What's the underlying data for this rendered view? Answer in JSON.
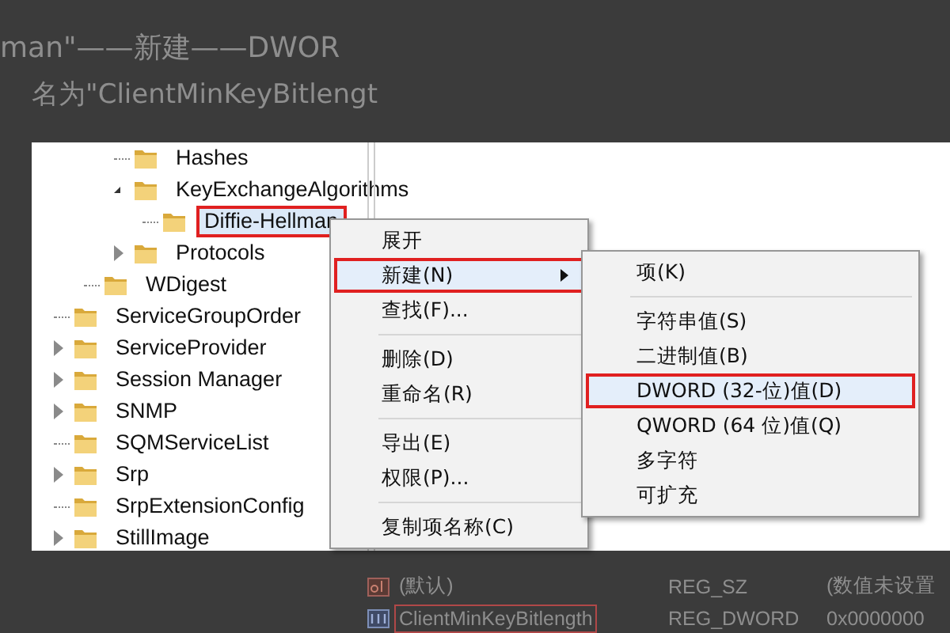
{
  "background_article": {
    "heading_line": "man\"——新建——DWOR",
    "text_line": "名为\"ClientMinKeyBitlengt",
    "values_table": [
      {
        "name": "(默认)",
        "type": "REG_SZ",
        "data": "(数值未设置",
        "kind": "string",
        "highlighted": false
      },
      {
        "name": "ClientMinKeyBitlength",
        "type": "REG_DWORD",
        "data": "0x0000000",
        "kind": "dword",
        "highlighted": true
      }
    ]
  },
  "tree": [
    {
      "children": [
        {
          "children": [
            {
              "label": "Hashes",
              "kind": "leaf",
              "selected": false,
              "highlighted": false
            },
            {
              "label": "KeyExchangeAlgorithms",
              "kind": "expanded",
              "selected": false,
              "highlighted": false,
              "children": [
                {
                  "label": "Diffie-Hellman",
                  "kind": "leaf",
                  "selected": true,
                  "highlighted": true
                }
              ]
            },
            {
              "label": "Protocols",
              "kind": "collapsed",
              "selected": false,
              "highlighted": false
            }
          ]
        },
        {
          "label": "WDigest",
          "kind": "leaf",
          "selected": false,
          "highlighted": false
        }
      ]
    },
    {
      "label": "ServiceGroupOrder",
      "kind": "leaf",
      "selected": false,
      "highlighted": false
    },
    {
      "label": "ServiceProvider",
      "kind": "collapsed",
      "selected": false,
      "highlighted": false
    },
    {
      "label": "Session Manager",
      "kind": "collapsed",
      "selected": false,
      "highlighted": false
    },
    {
      "label": "SNMP",
      "kind": "collapsed",
      "selected": false,
      "highlighted": false
    },
    {
      "label": "SQMServiceList",
      "kind": "leaf",
      "selected": false,
      "highlighted": false
    },
    {
      "label": "Srp",
      "kind": "collapsed",
      "selected": false,
      "highlighted": false
    },
    {
      "label": "SrpExtensionConfig",
      "kind": "leaf",
      "selected": false,
      "highlighted": false
    },
    {
      "label": "StillImage",
      "kind": "collapsed",
      "selected": false,
      "highlighted": false
    }
  ],
  "context_menu": [
    {
      "kind": "item",
      "label": "展开",
      "selected": false,
      "highlighted": false,
      "submenu": false
    },
    {
      "kind": "item",
      "label": "新建(N)",
      "selected": true,
      "highlighted": true,
      "submenu": true
    },
    {
      "kind": "item",
      "label": "查找(F)...",
      "selected": false,
      "highlighted": false,
      "submenu": false
    },
    {
      "kind": "separator"
    },
    {
      "kind": "item",
      "label": "删除(D)",
      "selected": false,
      "highlighted": false,
      "submenu": false
    },
    {
      "kind": "item",
      "label": "重命名(R)",
      "selected": false,
      "highlighted": false,
      "submenu": false
    },
    {
      "kind": "separator"
    },
    {
      "kind": "item",
      "label": "导出(E)",
      "selected": false,
      "highlighted": false,
      "submenu": false
    },
    {
      "kind": "item",
      "label": "权限(P)...",
      "selected": false,
      "highlighted": false,
      "submenu": false
    },
    {
      "kind": "separator"
    },
    {
      "kind": "item",
      "label": "复制项名称(C)",
      "selected": false,
      "highlighted": false,
      "submenu": false
    }
  ],
  "submenu": [
    {
      "kind": "item",
      "label": "项(K)",
      "selected": false,
      "highlighted": false
    },
    {
      "kind": "separator"
    },
    {
      "kind": "item",
      "label": "字符串值(S)",
      "selected": false,
      "highlighted": false
    },
    {
      "kind": "item",
      "label": "二进制值(B)",
      "selected": false,
      "highlighted": false
    },
    {
      "kind": "item",
      "label": "DWORD (32-位)值(D)",
      "selected": true,
      "highlighted": true
    },
    {
      "kind": "item",
      "label": "QWORD (64 位)值(Q)",
      "selected": false,
      "highlighted": false
    },
    {
      "kind": "item",
      "label": "多字符",
      "selected": false,
      "highlighted": false
    },
    {
      "kind": "item",
      "label": "可扩充",
      "selected": false,
      "highlighted": false
    }
  ]
}
